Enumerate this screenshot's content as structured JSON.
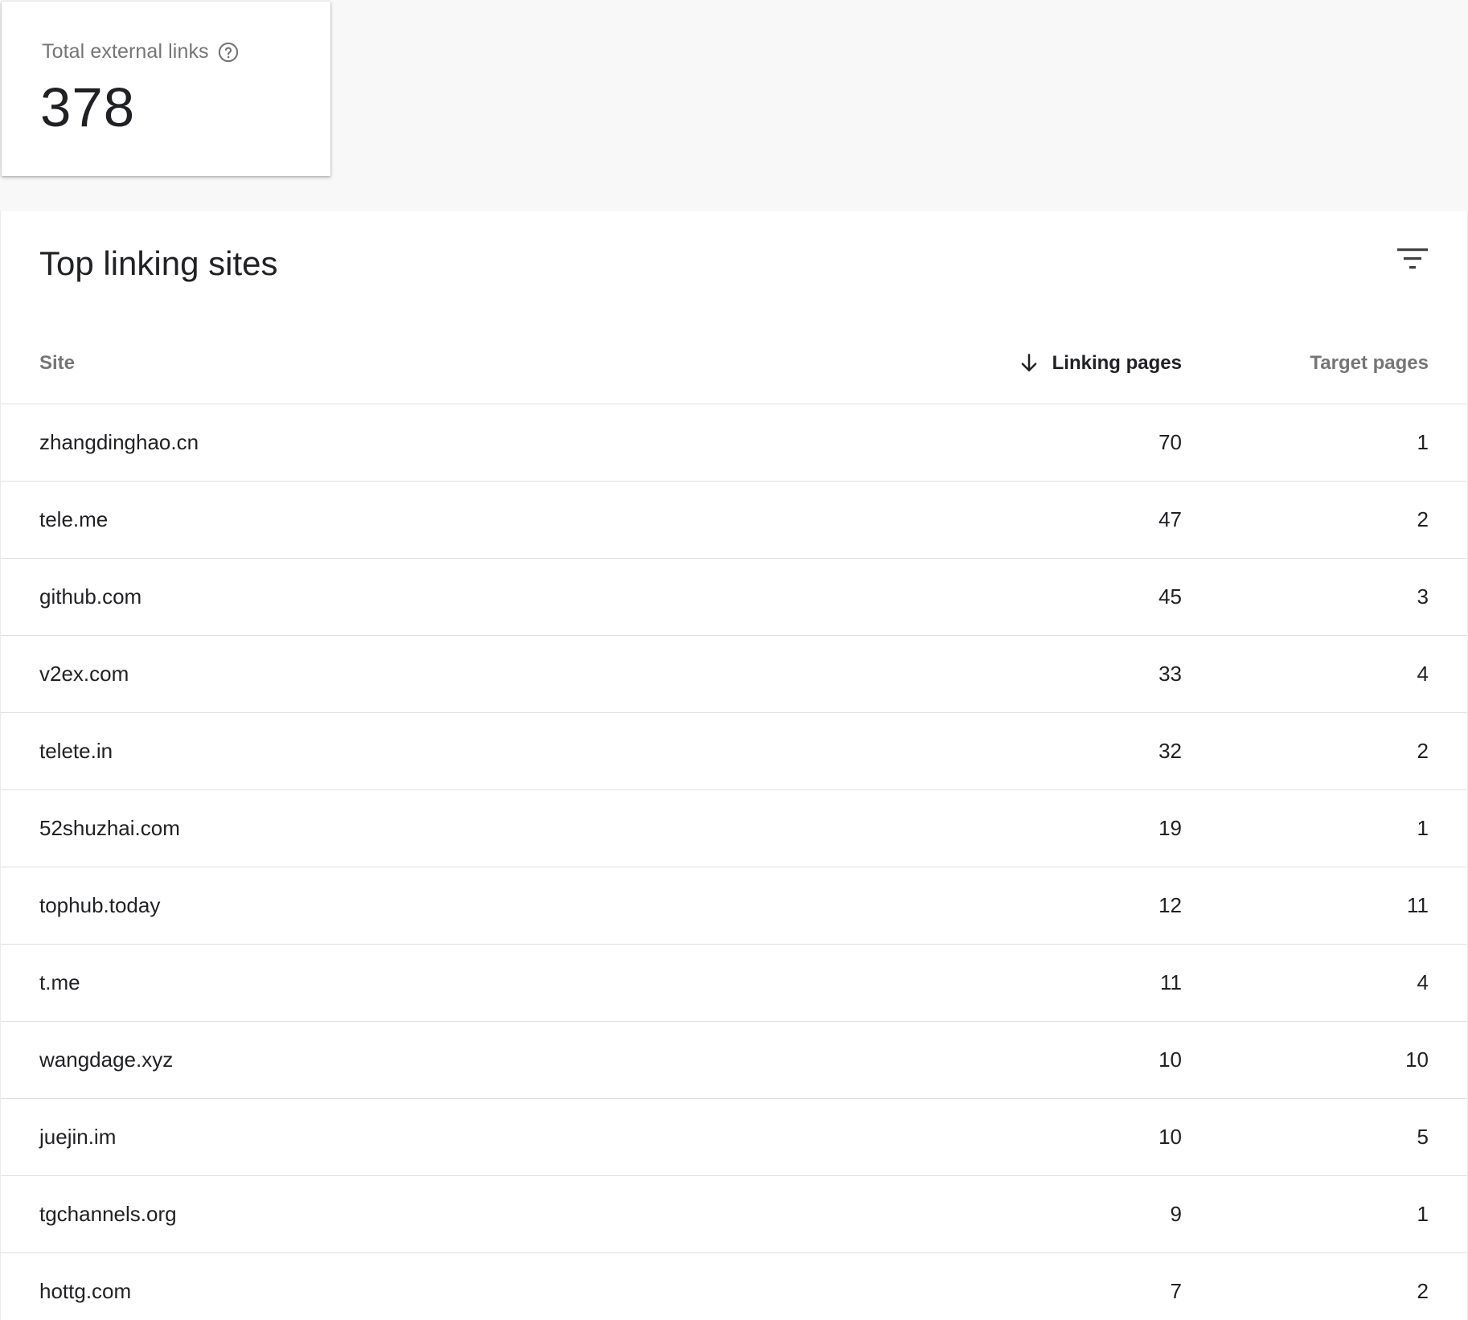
{
  "summary": {
    "label": "Total external links",
    "value": "378",
    "help_icon": "help-circle-icon"
  },
  "table": {
    "title": "Top linking sites",
    "filter_icon": "filter-icon",
    "headers": {
      "site": "Site",
      "linking_pages": "Linking pages",
      "target_pages": "Target pages"
    },
    "sort": {
      "column": "linking_pages",
      "direction": "descending",
      "icon": "arrow-down-icon"
    },
    "rows": [
      {
        "site": "zhangdinghao.cn",
        "linking_pages": "70",
        "target_pages": "1"
      },
      {
        "site": "tele.me",
        "linking_pages": "47",
        "target_pages": "2"
      },
      {
        "site": "github.com",
        "linking_pages": "45",
        "target_pages": "3"
      },
      {
        "site": "v2ex.com",
        "linking_pages": "33",
        "target_pages": "4"
      },
      {
        "site": "telete.in",
        "linking_pages": "32",
        "target_pages": "2"
      },
      {
        "site": "52shuzhai.com",
        "linking_pages": "19",
        "target_pages": "1"
      },
      {
        "site": "tophub.today",
        "linking_pages": "12",
        "target_pages": "11"
      },
      {
        "site": "t.me",
        "linking_pages": "11",
        "target_pages": "4"
      },
      {
        "site": "wangdage.xyz",
        "linking_pages": "10",
        "target_pages": "10"
      },
      {
        "site": "juejin.im",
        "linking_pages": "10",
        "target_pages": "5"
      },
      {
        "site": "tgchannels.org",
        "linking_pages": "9",
        "target_pages": "1"
      },
      {
        "site": "hottg.com",
        "linking_pages": "7",
        "target_pages": "2"
      }
    ]
  },
  "colors": {
    "page_background": "#f8f8f8",
    "card_background": "#ffffff",
    "primary_text": "#202124",
    "secondary_text": "#757575",
    "divider": "#e0e0e0"
  }
}
